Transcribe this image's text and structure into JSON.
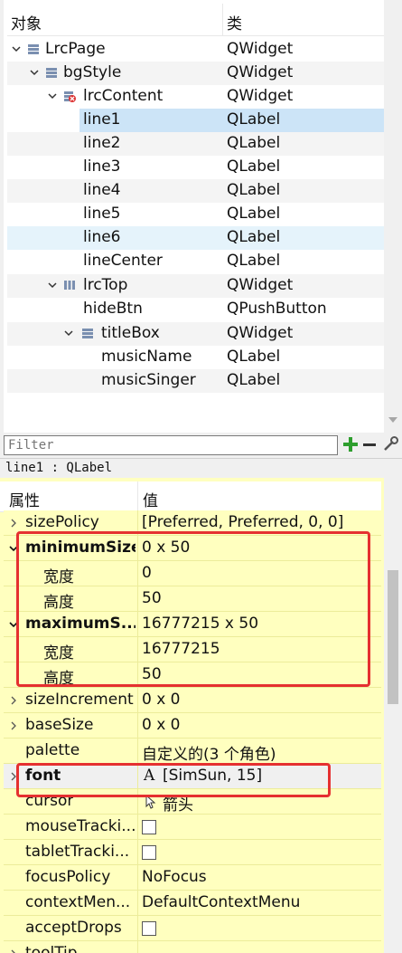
{
  "object_tree": {
    "col_object": "对象",
    "col_class": "类",
    "rows": [
      {
        "name": "LrcPage",
        "class": "QWidget"
      },
      {
        "name": "bgStyle",
        "class": "QWidget"
      },
      {
        "name": "lrcContent",
        "class": "QWidget"
      },
      {
        "name": "line1",
        "class": "QLabel"
      },
      {
        "name": "line2",
        "class": "QLabel"
      },
      {
        "name": "line3",
        "class": "QLabel"
      },
      {
        "name": "line4",
        "class": "QLabel"
      },
      {
        "name": "line5",
        "class": "QLabel"
      },
      {
        "name": "line6",
        "class": "QLabel"
      },
      {
        "name": "lineCenter",
        "class": "QLabel"
      },
      {
        "name": "lrcTop",
        "class": "QWidget"
      },
      {
        "name": "hideBtn",
        "class": "QPushButton"
      },
      {
        "name": "titleBox",
        "class": "QWidget"
      },
      {
        "name": "musicName",
        "class": "QLabel"
      },
      {
        "name": "musicSinger",
        "class": "QLabel"
      }
    ]
  },
  "filter": {
    "placeholder": "Filter"
  },
  "selected_label": "line1 : QLabel",
  "property_editor": {
    "col_property": "属性",
    "col_value": "值",
    "rows": [
      {
        "name": "sizePolicy",
        "value": "[Preferred, Preferred, 0, 0]"
      },
      {
        "name": "minimumSize",
        "value": "0 x 50"
      },
      {
        "name": "宽度",
        "value": "0"
      },
      {
        "name": "高度",
        "value": "50"
      },
      {
        "name": "maximumS...",
        "value": "16777215 x 50"
      },
      {
        "name": "宽度",
        "value": "16777215"
      },
      {
        "name": "高度",
        "value": "50"
      },
      {
        "name": "sizeIncrement",
        "value": "0 x 0"
      },
      {
        "name": "baseSize",
        "value": "0 x 0"
      },
      {
        "name": "palette",
        "value": "自定义的(3 个角色)"
      },
      {
        "name": "font",
        "value": "[SimSun, 15]"
      },
      {
        "name": "cursor",
        "value": "箭头"
      },
      {
        "name": "mouseTracki...",
        "value": ""
      },
      {
        "name": "tabletTracki...",
        "value": ""
      },
      {
        "name": "focusPolicy",
        "value": "NoFocus"
      },
      {
        "name": "contextMen...",
        "value": "DefaultContextMenu"
      },
      {
        "name": "acceptDrops",
        "value": ""
      },
      {
        "name": "toolTip",
        "value": ""
      }
    ]
  },
  "colors": {
    "selection": "#cce4f7",
    "property_bg": "#ffffbf",
    "highlight_box": "#e53030"
  },
  "icons": {
    "widget": "widget-icon",
    "layout_stack": "stacked-layout-icon",
    "hbox": "horizontal-layout-icon",
    "font_glyph": "font-icon",
    "cursor_glyph": "arrow-cursor-icon"
  }
}
